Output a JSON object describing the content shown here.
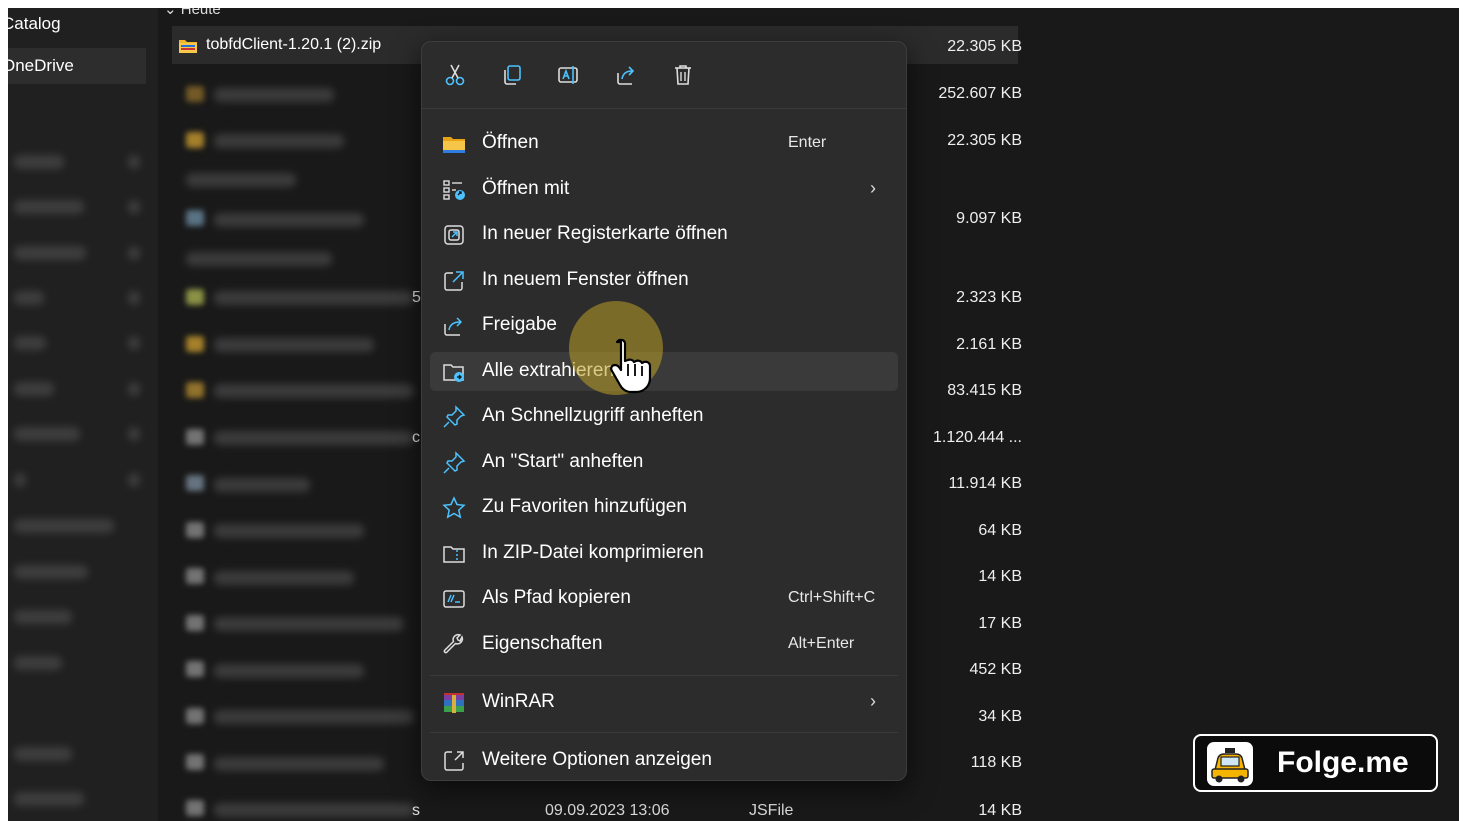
{
  "sidebar": {
    "items": [
      {
        "label": "Catalog"
      },
      {
        "label": "OneDrive"
      }
    ]
  },
  "file_list": {
    "group_header": "Heute",
    "selected_file": "tobfdClient-1.20.1 (2).zip",
    "sizes": [
      "22.305 KB",
      "252.607 KB",
      "22.305 KB",
      "9.097 KB",
      "2.323 KB",
      "2.161 KB",
      "83.415 KB",
      "1.120.444 ...",
      "11.914 KB",
      "64 KB",
      "14 KB",
      "17 KB",
      "452 KB",
      "34 KB",
      "118 KB",
      "14 KB"
    ],
    "bottom_row": {
      "date": "09.09.2023 13:06",
      "type": "JSFile",
      "fragment": "s"
    },
    "side_fragments": [
      "5",
      "c"
    ]
  },
  "context_menu": {
    "toolbar": [
      {
        "name": "cut-icon",
        "title": "Ausschneiden"
      },
      {
        "name": "copy-icon",
        "title": "Kopieren"
      },
      {
        "name": "rename-icon",
        "title": "Umbenennen"
      },
      {
        "name": "share-icon",
        "title": "Freigeben"
      },
      {
        "name": "delete-icon",
        "title": "Löschen"
      }
    ],
    "items": [
      {
        "label": "Öffnen",
        "shortcut": "Enter",
        "icon": "folder-open-icon"
      },
      {
        "label": "Öffnen mit",
        "shortcut": "",
        "icon": "open-with-icon",
        "submenu": true
      },
      {
        "label": "In neuer Registerkarte öffnen",
        "shortcut": "",
        "icon": "new-tab-icon"
      },
      {
        "label": "In neuem Fenster öffnen",
        "shortcut": "",
        "icon": "new-window-icon"
      },
      {
        "label": "Freigabe",
        "shortcut": "",
        "icon": "share-icon"
      },
      {
        "label": "Alle extrahieren",
        "shortcut": "",
        "icon": "extract-icon"
      },
      {
        "label": "An Schnellzugriff anheften",
        "shortcut": "",
        "icon": "pin-icon"
      },
      {
        "label": "An \"Start\" anheften",
        "shortcut": "",
        "icon": "pin-icon"
      },
      {
        "label": "Zu Favoriten hinzufügen",
        "shortcut": "",
        "icon": "star-icon"
      },
      {
        "label": "In ZIP-Datei komprimieren",
        "shortcut": "",
        "icon": "zip-compress-icon"
      },
      {
        "label": "Als Pfad kopieren",
        "shortcut": "Ctrl+Shift+C",
        "icon": "copy-path-icon"
      },
      {
        "label": "Eigenschaften",
        "shortcut": "Alt+Enter",
        "icon": "wrench-icon"
      },
      {
        "label": "WinRAR",
        "shortcut": "",
        "icon": "winrar-icon",
        "submenu": true
      },
      {
        "label": "Weitere Optionen anzeigen",
        "shortcut": "",
        "icon": "more-options-icon"
      }
    ],
    "hovered_item": "Alle extrahieren",
    "chevron": "›"
  },
  "badge": {
    "text": "Folge.me"
  },
  "colors": {
    "accent": "#4cc2ff",
    "menu_bg": "#2c2c2c",
    "highlight": "#bea028",
    "folder": "#f2b62b"
  }
}
